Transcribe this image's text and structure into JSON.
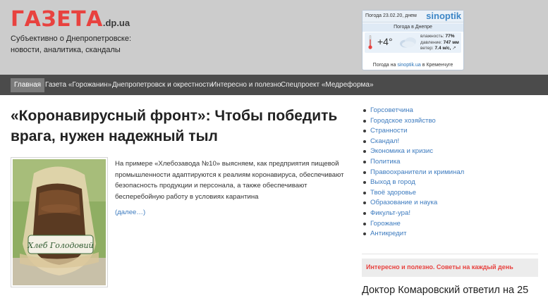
{
  "site": {
    "logo_main": "ГАЗЕТА",
    "logo_sub": ".dp.ua",
    "tagline_line1": "Субъективно о Днепропетровске:",
    "tagline_line2": "новости, аналитика, скандалы"
  },
  "weather": {
    "date": "Погода 23.02.20, днем",
    "brand": "sinoptik",
    "city": "Погода в Днепре",
    "temperature": "+4°",
    "humidity_label": "влажность:",
    "humidity_value": "77%",
    "pressure_label": "давление:",
    "pressure_value": "747 мм",
    "wind_label": "ветер:",
    "wind_value": "7.4 м/с,",
    "footer_prefix": "Погода на",
    "footer_link": "sinoptik.ua",
    "footer_suffix": "в Кременчуге",
    "icon": "cloud-icon"
  },
  "nav": {
    "items": [
      {
        "label": "Главная",
        "active": true
      },
      {
        "label": "Газета «Горожанин»"
      },
      {
        "label": "Днепропетровск и окрестности"
      },
      {
        "label": "Интересно и полезно"
      },
      {
        "label": "Спецпроект «Медреформа»"
      }
    ]
  },
  "article": {
    "title": "«Коронавирусный фронт»: Чтобы победить врага, нужен надежный тыл",
    "excerpt": "На примере «Хлебозавода №10» выясняем, как предприятия пищевой промышленности адаптируются к реалиям коронавируса, обеспечивают безопасность продукции и персонала, а также обеспечивают бесперебойную работу в условиях карантина",
    "more_label": "(далее…)",
    "image_text": "Хлеб Голодовий"
  },
  "sidebar": {
    "categories": [
      "Горсоветчина",
      "Городское хозяйство",
      "Странности",
      "Скандал!",
      "Экономика и кризис",
      "Политика",
      "Правоохранители и криминал",
      "Выход в город",
      "Твоё здоровье",
      "Образование и наука",
      "Фикульт-ура!",
      "Горожане",
      "Антикредит"
    ],
    "promo": "Интересно и полезно. Советы на каждый день",
    "headline": "Доктор Комаровский ответил на 25"
  },
  "colors": {
    "accent": "#e8423f",
    "link": "#3d7bbf",
    "header_bg": "#cccccc",
    "nav_bg": "#4b4b4b"
  }
}
